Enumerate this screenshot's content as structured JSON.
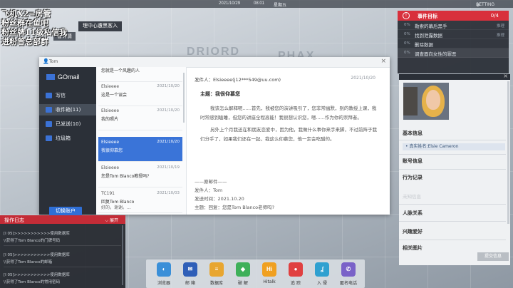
{
  "topbar": {
    "date": "2021/10/29",
    "time": "08:01",
    "weekday": "星期五",
    "settings": "SETTING"
  },
  "overlay": {
    "lines": [
      "飞机X2=房管",
      "粉丝群在鱼吧",
      "粉丝牌11级私信我",
      "进粉普总部群"
    ],
    "notification": "理中心遭黑客入",
    "notification2": "看详情"
  },
  "map_labels": [
    "DRIORD",
    "PHAX"
  ],
  "objectives": {
    "title": "事件目标",
    "count": "0/4",
    "items": [
      {
        "pct": "0%",
        "label": "勒索的幕后黑手",
        "hint": "推理"
      },
      {
        "pct": "0%",
        "label": "找到泄露数据",
        "hint": "推理"
      },
      {
        "pct": "0%",
        "label": "删除数据",
        "hint": ""
      },
      {
        "pct": "0%",
        "label": "调查面向女性的罪恶",
        "hint": ""
      }
    ]
  },
  "window": {
    "user": "Tom",
    "close": "×"
  },
  "gomail": {
    "logo": "GOmail",
    "nav": [
      {
        "label": "写信"
      },
      {
        "label": "收件箱(11)"
      },
      {
        "label": "已发送(10)"
      },
      {
        "label": "垃圾箱"
      }
    ],
    "switch_account": "切换账户"
  },
  "mail_list": [
    {
      "from": "",
      "date": "",
      "subject": "您就是一个风趣的人",
      "preview": ""
    },
    {
      "from": "Elsieeee",
      "date": "2021/10/20",
      "subject": "这是一个误会",
      "preview": ""
    },
    {
      "from": "Elsieeee",
      "date": "2021/10/20",
      "subject": "我的照片",
      "preview": ""
    },
    {
      "from": "Elsieeee",
      "date": "2021/10/20",
      "subject": "我很仰慕您",
      "preview": ""
    },
    {
      "from": "Elsieeee",
      "date": "2021/10/19",
      "subject": "您是Tom Blanco教授吗?",
      "preview": ""
    },
    {
      "from": "TC191",
      "date": "2021/10/03",
      "subject": "回复Tom Blanco",
      "preview": "好的，谢谢。..."
    }
  ],
  "reader": {
    "from": "发件人：Elsieeee(j12***549@uu.com)",
    "date": "2021/10/20",
    "subject": "主题：我很仰慕您",
    "paragraphs": [
      "我该怎么解释呢......首先，我被您的演讲吸引了，您非常幽默，别的教授上课，我时常感到瞌睡，但您的讲座全程高能！我很想认识您，嗯......作为你的崇拜者。",
      "另外上个月我还在和朋友恋爱中，因为他，我做什么事你来手来脚，不过前阵子我们分手了，如果我们还在一起，我这么仰慕您，他一定会吃醋的。"
    ],
    "quote_lines": [
      "——原邮件——",
      "发件人：Tom",
      "发送时间：2021.10.20",
      "主题：回复：您是Tom Blanco老师吗?"
    ]
  },
  "profile": {
    "close": "×",
    "sections": [
      "基本信息",
      "账号信息",
      "行为记录",
      "人脉关系",
      "兴趣爱好",
      "相关图片"
    ],
    "real_name": "• 真实姓名:Elsie Cameron",
    "muted": [
      "未知信息"
    ],
    "submit": "提交信息"
  },
  "log": {
    "title": "操作日志",
    "expand": "展开",
    "entries": [
      [
        "[I 05]>>>>>>>>>>>使用数据库",
        "\\\\获得了Tom Blanco的门牌号码"
      ],
      [
        "[I 05]>>>>>>>>>>>使用数据库",
        "\\\\获得了Tom Blanco的邮箱"
      ],
      [
        "[I 05]>>>>>>>>>>>使用数据库",
        "\\\\获得了Tom Blanco的常用密码"
      ]
    ]
  },
  "dock": [
    {
      "label": "浏览器",
      "icon": "browser-icon",
      "color": "#3a8fd8",
      "glyph": "◐"
    },
    {
      "label": "邮 箱",
      "icon": "mail-icon",
      "color": "#2f5fb8",
      "glyph": "✉"
    },
    {
      "label": "数据库",
      "icon": "database-icon",
      "color": "#e8a630",
      "glyph": "≡"
    },
    {
      "label": "破 解",
      "icon": "crack-icon",
      "color": "#3eb05a",
      "glyph": "◆"
    },
    {
      "label": "Hitalk",
      "icon": "hitalk-icon",
      "color": "#f0a020",
      "glyph": "Hi"
    },
    {
      "label": "追 踪",
      "icon": "track-icon",
      "color": "#e04040",
      "glyph": "●"
    },
    {
      "label": "入 侵",
      "icon": "intrude-icon",
      "color": "#2fa0d0",
      "glyph": "ʆ"
    },
    {
      "label": "匿名电话",
      "icon": "phone-icon",
      "color": "#7a62c8",
      "glyph": "✆"
    }
  ]
}
